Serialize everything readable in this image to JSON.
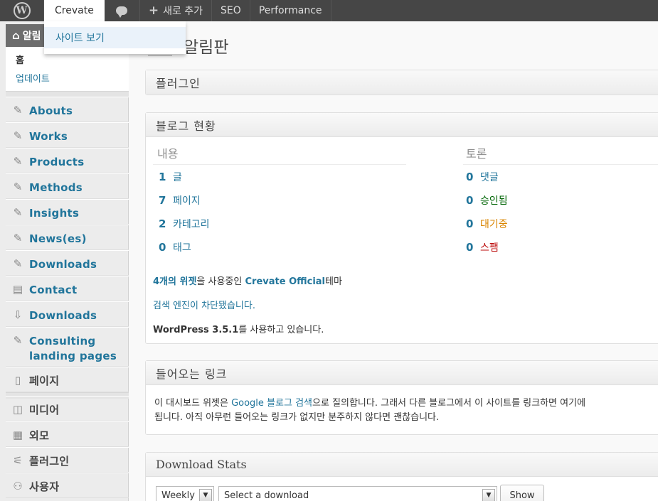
{
  "adminbar": {
    "site_name": "Crevate",
    "new_label": "새로 추가",
    "seo_label": "SEO",
    "performance_label": "Performance"
  },
  "dropdown": {
    "view_site": "사이트 보기"
  },
  "sidebar": {
    "dashboard_label": "알림",
    "sub_home": "홈",
    "sub_update": "업데이트",
    "items": [
      {
        "label": "Abouts",
        "icon": "pin-icon"
      },
      {
        "label": "Works",
        "icon": "pin-icon"
      },
      {
        "label": "Products",
        "icon": "pin-icon"
      },
      {
        "label": "Methods",
        "icon": "pin-icon"
      },
      {
        "label": "Insights",
        "icon": "pin-icon"
      },
      {
        "label": "News(es)",
        "icon": "pin-icon"
      },
      {
        "label": "Downloads",
        "icon": "pin-icon"
      },
      {
        "label": "Contact",
        "icon": "form-icon"
      },
      {
        "label": "Downloads",
        "icon": "download-icon"
      },
      {
        "label": "Consulting landing pages",
        "icon": "pin-icon"
      },
      {
        "label": "페이지",
        "icon": "pages-icon"
      },
      {
        "label": "미디어",
        "icon": "media-icon"
      },
      {
        "label": "외모",
        "icon": "appearance-icon"
      },
      {
        "label": "플러그인",
        "icon": "plugin-icon"
      },
      {
        "label": "사용자",
        "icon": "users-icon"
      }
    ]
  },
  "main": {
    "page_title": "알림판",
    "plugins_box_title": "플러그인",
    "right_now": {
      "title": "블로그 현황",
      "content_col": "내용",
      "discussion_col": "토론",
      "content_rows": [
        {
          "num": "1",
          "label": "글"
        },
        {
          "num": "7",
          "label": "페이지"
        },
        {
          "num": "2",
          "label": "카테고리"
        },
        {
          "num": "0",
          "label": "태그"
        }
      ],
      "discussion_rows": [
        {
          "num": "0",
          "label": "댓글"
        },
        {
          "num": "0",
          "label": "승인됨"
        },
        {
          "num": "0",
          "label": "대기중"
        },
        {
          "num": "0",
          "label": "스팸"
        }
      ],
      "widgets_count": "4개의 위젯",
      "widgets_mid": "을 사용중인 ",
      "theme_name": "Crevate Official",
      "widgets_end": "테마",
      "search_blocked": "검색 엔진이 차단됐습니다.",
      "wp_version": "WordPress 3.5.1",
      "wp_version_suffix": "를 사용하고 있습니다."
    },
    "incoming": {
      "title": "들어오는 링크",
      "line1_pre": "이 대시보드 위젯은 ",
      "line1_link": "Google 블로그 검색",
      "line1_post": "으로 질의합니다. 그래서 다른 블로그에서 이 사이트를 링크하면 여기에",
      "line2": "됩니다. 아직 아무런 들어오는 링크가 없지만 분주하지 않다면 괜찮습니다."
    },
    "download_stats": {
      "title": "Download Stats",
      "period_value": "Weekly",
      "download_value": "Select a download",
      "show_button": "Show"
    }
  }
}
